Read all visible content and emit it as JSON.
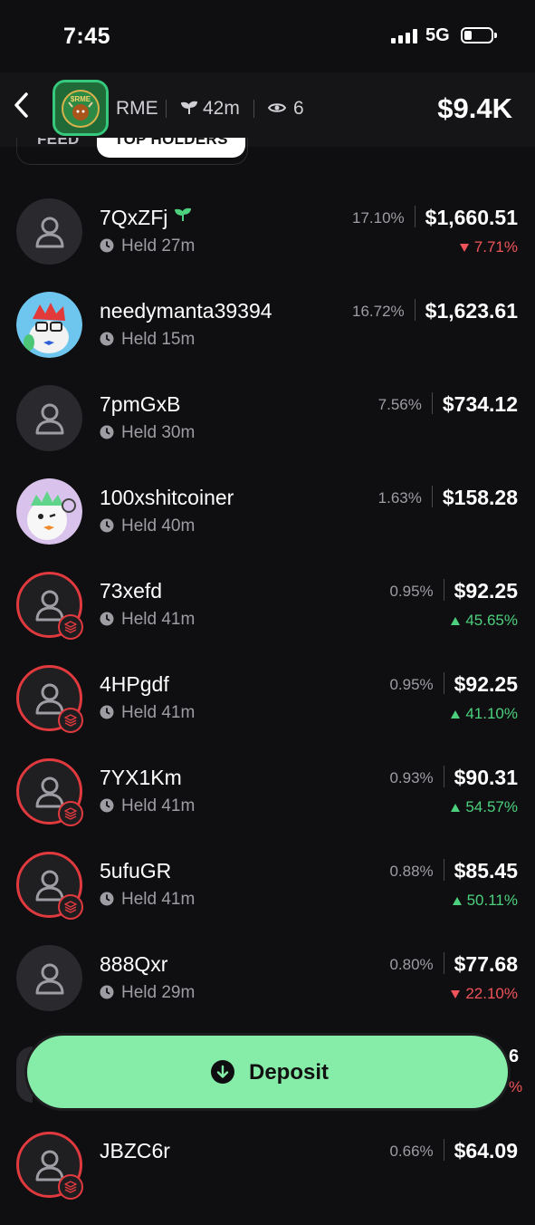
{
  "status_bar": {
    "time": "7:45",
    "network": "5G"
  },
  "header": {
    "token_symbol": "RME",
    "token_logo_text": "$RME",
    "holders_age": "42m",
    "viewers": "6",
    "market_cap": "$9.4K"
  },
  "tabs": [
    {
      "label": "FEED",
      "active": false
    },
    {
      "label": "TOP HOLDERS",
      "active": true
    }
  ],
  "holders": [
    {
      "name": "7QxZFj",
      "held": "Held 27m",
      "pct": "17.10%",
      "value": "$1,660.51",
      "change": "7.71%",
      "direction": "down",
      "avatar": "default",
      "sprout": true,
      "ring": false
    },
    {
      "name": "needymanta39394",
      "held": "Held 15m",
      "pct": "16.72%",
      "value": "$1,623.61",
      "change": "",
      "direction": "",
      "avatar": "manta",
      "sprout": false,
      "ring": false
    },
    {
      "name": "7pmGxB",
      "held": "Held 30m",
      "pct": "7.56%",
      "value": "$734.12",
      "change": "",
      "direction": "",
      "avatar": "default",
      "sprout": false,
      "ring": false
    },
    {
      "name": "100xshitcoiner",
      "held": "Held 40m",
      "pct": "1.63%",
      "value": "$158.28",
      "change": "",
      "direction": "",
      "avatar": "creature",
      "sprout": false,
      "ring": false
    },
    {
      "name": "73xefd",
      "held": "Held 41m",
      "pct": "0.95%",
      "value": "$92.25",
      "change": "45.65%",
      "direction": "up",
      "avatar": "default",
      "sprout": false,
      "ring": true
    },
    {
      "name": "4HPgdf",
      "held": "Held 41m",
      "pct": "0.95%",
      "value": "$92.25",
      "change": "41.10%",
      "direction": "up",
      "avatar": "default",
      "sprout": false,
      "ring": true
    },
    {
      "name": "7YX1Km",
      "held": "Held 41m",
      "pct": "0.93%",
      "value": "$90.31",
      "change": "54.57%",
      "direction": "up",
      "avatar": "default",
      "sprout": false,
      "ring": true
    },
    {
      "name": "5ufuGR",
      "held": "Held 41m",
      "pct": "0.88%",
      "value": "$85.45",
      "change": "50.11%",
      "direction": "up",
      "avatar": "default",
      "sprout": false,
      "ring": true
    },
    {
      "name": "888Qxr",
      "held": "Held 29m",
      "pct": "0.80%",
      "value": "$77.68",
      "change": "22.10%",
      "direction": "down",
      "avatar": "default",
      "sprout": false,
      "ring": false
    },
    {
      "name": "JBZC6r",
      "held": "",
      "pct": "0.66%",
      "value": "$64.09",
      "change": "",
      "direction": "",
      "avatar": "default",
      "sprout": false,
      "ring": true
    }
  ],
  "partial_row": {
    "value_fragment": "6",
    "change_fragment": "%"
  },
  "deposit": {
    "label": "Deposit"
  },
  "colors": {
    "up": "#4cd07d",
    "down": "#f0545a",
    "deposit": "#86eda8",
    "ring": "#e0393e",
    "accent": "#36c87c"
  },
  "icons": {
    "back": "chevron-left-icon",
    "holders": "sprout-icon",
    "viewers": "eye-icon",
    "held": "clock-icon",
    "avatar": "person-icon",
    "badge": "layers-icon",
    "deposit": "arrow-down-circle-icon"
  }
}
